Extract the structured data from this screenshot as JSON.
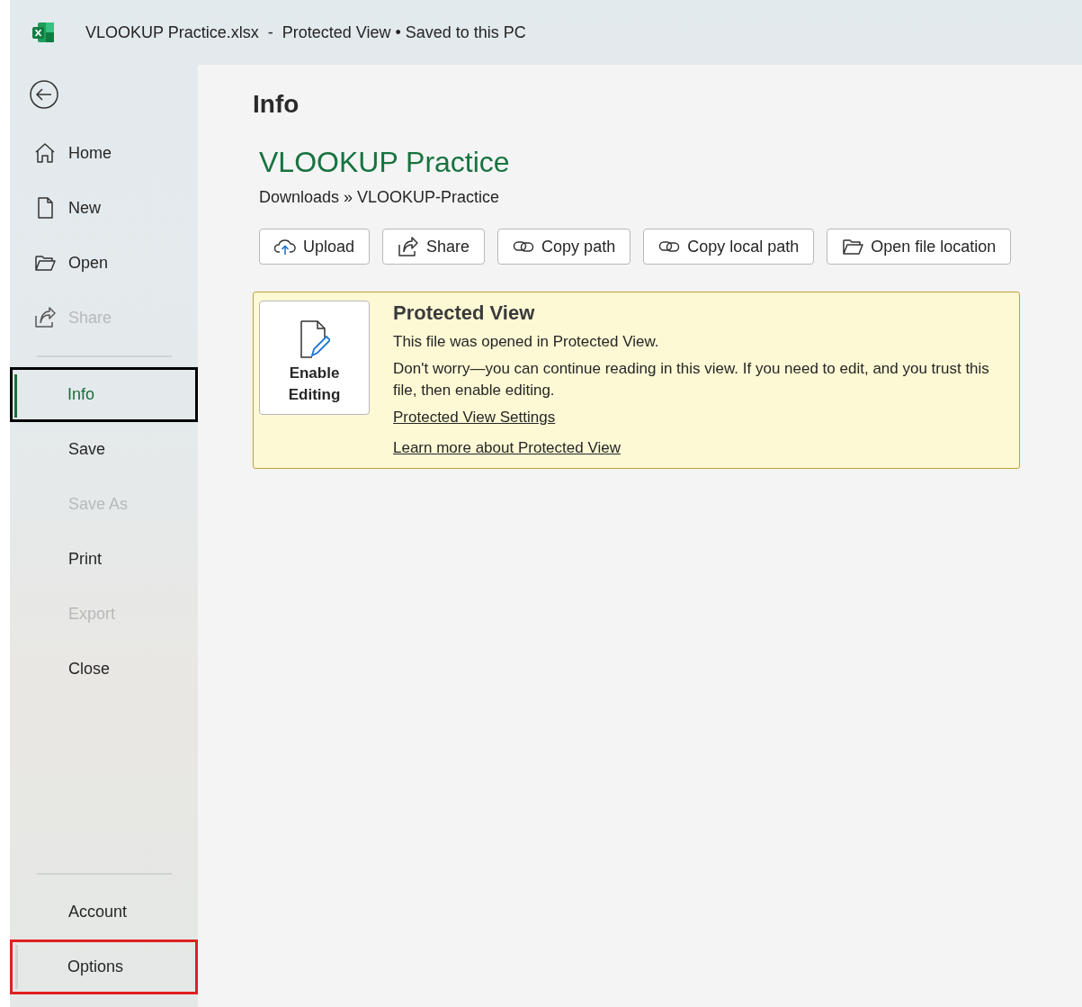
{
  "window": {
    "title": "VLOOKUP Practice.xlsx  -  Protected View • Saved to this PC"
  },
  "sidebar": {
    "groups": [
      {
        "items": [
          {
            "label": "Home",
            "selected": false,
            "disabled": false,
            "hovered": false
          },
          {
            "label": "New",
            "selected": false,
            "disabled": false,
            "hovered": false
          },
          {
            "label": "Open",
            "selected": false,
            "disabled": false,
            "hovered": false
          },
          {
            "label": "Share",
            "selected": false,
            "disabled": true,
            "hovered": false
          }
        ]
      },
      {
        "items": [
          {
            "label": "Info",
            "selected": true,
            "disabled": false,
            "hovered": false,
            "color": "#000000"
          },
          {
            "label": "Save",
            "selected": false,
            "disabled": false,
            "hovered": false
          },
          {
            "label": "Save As",
            "selected": false,
            "disabled": true,
            "hovered": false
          },
          {
            "label": "Print",
            "selected": false,
            "disabled": false,
            "hovered": false
          },
          {
            "label": "Export",
            "selected": false,
            "disabled": true,
            "hovered": false
          },
          {
            "label": "Close",
            "selected": false,
            "disabled": false,
            "hovered": false
          }
        ]
      },
      {
        "items": [
          {
            "label": "Account",
            "selected": false,
            "disabled": false,
            "hovered": false
          },
          {
            "label": "Options",
            "selected": false,
            "disabled": false,
            "hovered": true,
            "color": "#e02020"
          }
        ]
      }
    ]
  },
  "page": {
    "heading": "Info",
    "file_name": "VLOOKUP Practice",
    "breadcrumb": "Downloads » VLOOKUP-Practice",
    "actions": [
      "Upload",
      "Share",
      "Copy path",
      "Copy local path",
      "Open file location"
    ],
    "banner": {
      "button": "Enable Editing",
      "title": "Protected View",
      "lines": [
        "This file was opened in Protected View.",
        "Don't worry—you can continue reading in this view. If you need to edit, and you trust this file, then enable editing."
      ],
      "links": [
        "Protected View Settings",
        "Learn more about Protected View"
      ]
    }
  }
}
